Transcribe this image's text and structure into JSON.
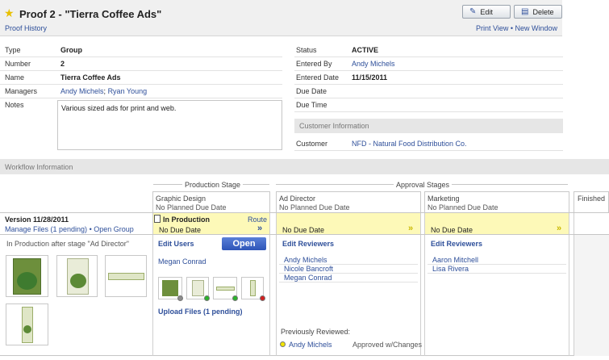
{
  "header": {
    "title": "Proof 2 - \"Tierra Coffee Ads\"",
    "proof_history": "Proof History",
    "edit_label": "Edit",
    "delete_label": "Delete",
    "print_view": "Print View",
    "separator": "•",
    "new_window": "New Window"
  },
  "details_left": {
    "type_label": "Type",
    "type_value": "Group",
    "number_label": "Number",
    "number_value": "2",
    "name_label": "Name",
    "name_value": "Tierra Coffee Ads",
    "managers_label": "Managers",
    "manager_1": "Andy Michels",
    "manager_sep": ";",
    "manager_2": "Ryan Young",
    "notes_label": "Notes",
    "notes_value": "Various sized ads for print and web."
  },
  "details_right": {
    "status_label": "Status",
    "status_value": "ACTIVE",
    "entered_by_label": "Entered By",
    "entered_by_value": "Andy Michels",
    "entered_date_label": "Entered Date",
    "entered_date_value": "11/15/2011",
    "due_date_label": "Due Date",
    "due_time_label": "Due Time",
    "customer_info_header": "Customer Information",
    "customer_label": "Customer",
    "customer_value": "NFD - Natural Food Distribution Co."
  },
  "workflow": {
    "section_title": "Workflow Information",
    "production_stage": "Production Stage",
    "approval_stages": "Approval Stages",
    "version_label": "Version 11/28/2011",
    "manage_files": "Manage Files (1 pending)",
    "version_sep": "•",
    "open_group": "Open Group",
    "status_note": "In Production after stage \"Ad Director\"",
    "graphic_design": {
      "name": "Graphic Design",
      "planned": "No Planned Due Date",
      "state": "In Production",
      "route": "Route",
      "due": "No Due Date",
      "edit_users": "Edit Users",
      "open_button": "Open",
      "user_1": "Megan Conrad",
      "upload_files": "Upload Files (1 pending)"
    },
    "ad_director": {
      "name": "Ad Director",
      "planned": "No Planned Due Date",
      "due": "No Due Date",
      "edit_reviewers": "Edit Reviewers",
      "reviewer_1": "Andy Michels",
      "reviewer_2": "Nicole Bancroft",
      "reviewer_3": "Megan Conrad",
      "previously_reviewed": "Previously Reviewed:",
      "prev_reviewer": "Andy Michels",
      "prev_status": "Approved w/Changes"
    },
    "marketing": {
      "name": "Marketing",
      "planned": "No Planned Due Date",
      "due": "No Due Date",
      "edit_reviewers": "Edit Reviewers",
      "reviewer_1": "Aaron Mitchell",
      "reviewer_2": "Lisa Rivera"
    },
    "finished": "Finished"
  },
  "colors": {
    "link": "#2e4f9a",
    "highlight": "#fdf9b8",
    "open_button": "#3a64c8",
    "status_dot_gray": "#8c8c8c",
    "status_dot_green": "#2bb32b",
    "status_dot_red": "#d21f1f",
    "status_dot_yellow": "#f2e500"
  },
  "icons": [
    "star-icon",
    "edit-icon",
    "delete-icon",
    "document-icon",
    "double-chevron-icon"
  ]
}
